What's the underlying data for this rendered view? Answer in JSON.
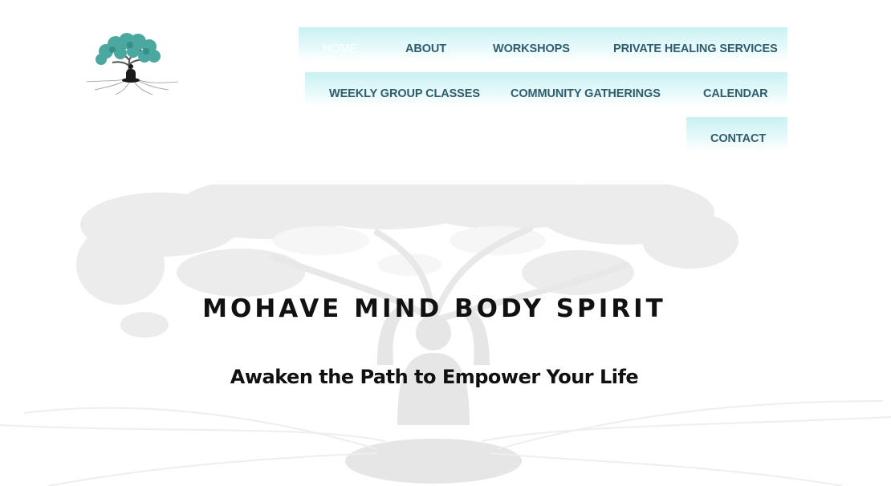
{
  "logo": {
    "icon": "tree-of-life-meditation-logo",
    "accent_color": "#4aa8a0"
  },
  "nav": {
    "row1": [
      {
        "label": "HOME",
        "active": true
      },
      {
        "label": "ABOUT"
      },
      {
        "label": "WORKSHOPS"
      },
      {
        "label": "PRIVATE HEALING SERVICES"
      }
    ],
    "row2": [
      {
        "label": "WEEKLY GROUP CLASSES"
      },
      {
        "label": "COMMUNITY GATHERINGS"
      },
      {
        "label": "CALENDAR"
      }
    ],
    "row3": [
      {
        "label": "CONTACT"
      }
    ],
    "colors": {
      "text": "#2f5d6e",
      "active_text": "#ffffff",
      "bar": "#c9f1f3"
    }
  },
  "hero": {
    "title": "MOHAVE MIND BODY SPIRIT",
    "tagline": "Awaken the Path to Empower Your Life",
    "background_icon": "tree-of-life-meditation-watermark"
  }
}
